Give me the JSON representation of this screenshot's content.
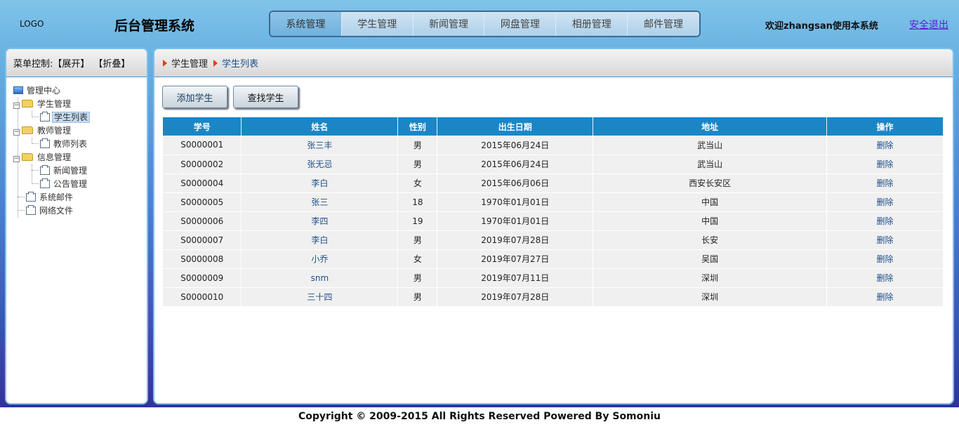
{
  "header": {
    "logo": "LOGO",
    "title": "后台管理系统",
    "nav": [
      "系统管理",
      "学生管理",
      "新闻管理",
      "网盘管理",
      "相册管理",
      "邮件管理"
    ],
    "welcome": "欢迎zhangsan使用本系统",
    "logout": "安全退出"
  },
  "sidebar": {
    "control_label": "菜单控制:",
    "expand": "【展开】",
    "collapse": "【折叠】",
    "root": "管理中心",
    "tree": [
      {
        "label": "学生管理",
        "children": [
          "学生列表"
        ]
      },
      {
        "label": "教师管理",
        "children": [
          "教师列表"
        ]
      },
      {
        "label": "信息管理",
        "children": [
          "新闻管理",
          "公告管理"
        ]
      }
    ],
    "leaves": [
      "系统邮件",
      "网络文件"
    ]
  },
  "breadcrumb": [
    "学生管理",
    "学生列表"
  ],
  "actions": {
    "add": "添加学生",
    "find": "查找学生"
  },
  "table": {
    "headers": [
      "学号",
      "姓名",
      "性别",
      "出生日期",
      "地址",
      "操作"
    ],
    "rows": [
      [
        "S0000001",
        "张三丰",
        "男",
        "2015年06月24日",
        "武当山",
        "删除"
      ],
      [
        "S0000002",
        "张无忌",
        "男",
        "2015年06月24日",
        "武当山",
        "删除"
      ],
      [
        "S0000004",
        "李白",
        "女",
        "2015年06月06日",
        "西安长安区",
        "删除"
      ],
      [
        "S0000005",
        "张三",
        "18",
        "1970年01月01日",
        "中国",
        "删除"
      ],
      [
        "S0000006",
        "李四",
        "19",
        "1970年01月01日",
        "中国",
        "删除"
      ],
      [
        "S0000007",
        "李白",
        "男",
        "2019年07月28日",
        "长安",
        "删除"
      ],
      [
        "S0000008",
        "小乔",
        "女",
        "2019年07月27日",
        "吴国",
        "删除"
      ],
      [
        "S0000009",
        "snm",
        "男",
        "2019年07月11日",
        "深圳",
        "删除"
      ],
      [
        "S0000010",
        "三十四",
        "男",
        "2019年07月28日",
        "深圳",
        "删除"
      ]
    ]
  },
  "footer": "Copyright © 2009-2015 All Rights Reserved Powered By Somoniu",
  "colors": {
    "table_header": "#1a86c6",
    "breadcrumb_arrow": "#d64416",
    "logout": "#5a1fd1"
  }
}
